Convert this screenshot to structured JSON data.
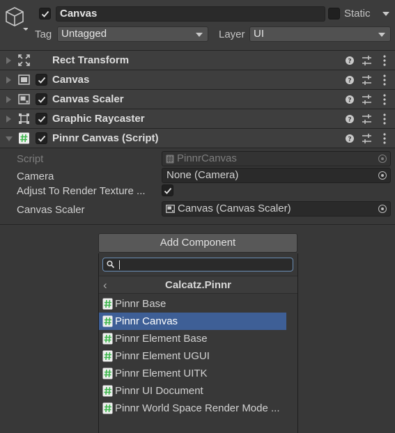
{
  "header": {
    "object_name": "Canvas",
    "static_label": "Static",
    "tag_label": "Tag",
    "tag_value": "Untagged",
    "layer_label": "Layer",
    "layer_value": "UI"
  },
  "components": [
    {
      "name": "Rect Transform",
      "icon": "rect-transform-icon",
      "has_checkbox": false,
      "expanded": false
    },
    {
      "name": "Canvas",
      "icon": "canvas-icon",
      "has_checkbox": true,
      "expanded": false
    },
    {
      "name": "Canvas Scaler",
      "icon": "canvas-scaler-icon",
      "has_checkbox": true,
      "expanded": false
    },
    {
      "name": "Graphic Raycaster",
      "icon": "graphic-raycaster-icon",
      "has_checkbox": true,
      "expanded": false
    },
    {
      "name": "Pinnr Canvas (Script)",
      "icon": "script-icon",
      "has_checkbox": true,
      "expanded": true
    }
  ],
  "properties": {
    "script": {
      "label": "Script",
      "value": "PinnrCanvas"
    },
    "camera": {
      "label": "Camera",
      "value": "None (Camera)"
    },
    "adjust": {
      "label": "Adjust To Render Texture ...",
      "checked": true
    },
    "canvas_scaler": {
      "label": "Canvas Scaler",
      "value": "Canvas (Canvas Scaler)"
    }
  },
  "add_component": {
    "button_label": "Add Component",
    "search_value": "",
    "category_title": "Calcatz.Pinnr",
    "items": [
      "Pinnr Base",
      "Pinnr Canvas",
      "Pinnr Element Base",
      "Pinnr Element UGUI",
      "Pinnr Element UITK",
      "Pinnr UI Document",
      "Pinnr World Space Render Mode ..."
    ],
    "selected_item": "Pinnr Canvas"
  },
  "colors": {
    "background": "#383838",
    "selection": "#3e5f96",
    "search_focus": "#6b8fb6",
    "script_icon": "#3bb54a"
  }
}
